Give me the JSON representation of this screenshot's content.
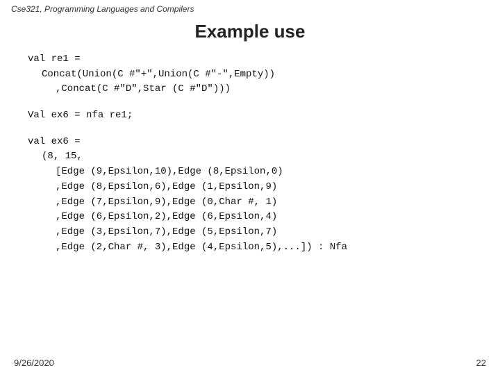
{
  "header": {
    "label": "Cse321, Programming Languages and Compilers"
  },
  "title": "Example use",
  "code": {
    "block1": {
      "line1": "val re1 =",
      "line2": "Concat(Union(C #\"+\",Union(C #\"-\",Empty))",
      "line3": ",Concat(C #\"D\",Star (C #\"D\")))"
    },
    "block2": {
      "line1": "Val ex6 = nfa re1;"
    },
    "block3": {
      "line1": "val ex6 =",
      "line2": "(8, 15,",
      "line3": "[Edge (9,Epsilon,10),Edge (8,Epsilon,0)",
      "line4": ",Edge (8,Epsilon,6),Edge (1,Epsilon,9)",
      "line5": ",Edge (7,Epsilon,9),Edge (0,Char #, 1)",
      "line6": ",Edge (6,Epsilon,2),Edge (6,Epsilon,4)",
      "line7": ",Edge (3,Epsilon,7),Edge (5,Epsilon,7)",
      "line8": ",Edge (2,Char #, 3),Edge (4,Epsilon,5),...]) : Nfa"
    }
  },
  "footer": {
    "date": "9/26/2020",
    "page": "22"
  }
}
